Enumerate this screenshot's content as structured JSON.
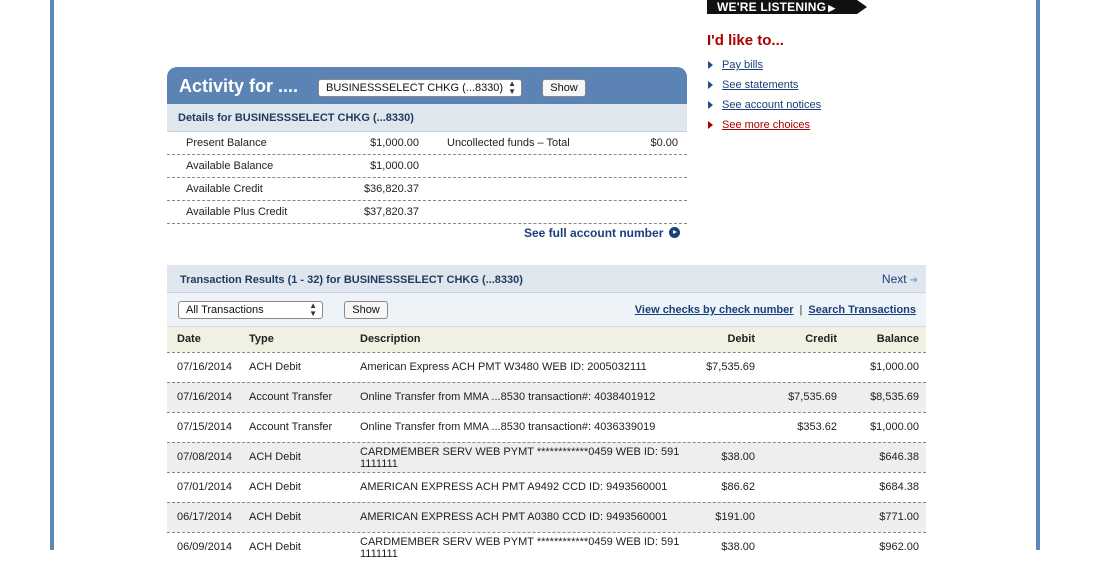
{
  "banner": {
    "text": "WE'RE LISTENING"
  },
  "like_to": {
    "heading": "I'd like to...",
    "items": [
      "Pay bills",
      "See statements",
      "See account notices",
      "See more choices"
    ]
  },
  "activity": {
    "title": "Activity for ....",
    "account_select": "BUSINESSSELECT CHKG (...8330)",
    "show_label": "Show",
    "details_title": "Details for BUSINESSSELECT CHKG (...8330)",
    "balances": [
      {
        "label": "Present Balance",
        "value": "$1,000.00",
        "label2": "Uncollected funds – Total",
        "value2": "$0.00"
      },
      {
        "label": "Available Balance",
        "value": "$1,000.00",
        "label2": "",
        "value2": ""
      },
      {
        "label": "Available Credit",
        "value": "$36,820.37",
        "label2": "",
        "value2": ""
      },
      {
        "label": "Available Plus Credit",
        "value": "$37,820.37",
        "label2": "",
        "value2": ""
      }
    ],
    "full_account_link": "See full account number"
  },
  "transactions": {
    "title": "Transaction Results (1 - 32) for BUSINESSSELECT CHKG (...8330)",
    "next_label": "Next",
    "filter_value": "All Transactions",
    "show_label": "Show",
    "link_checks": "View checks by check number",
    "link_search": "Search Transactions",
    "link_sep": "|",
    "columns": {
      "date": "Date",
      "type": "Type",
      "description": "Description",
      "debit": "Debit",
      "credit": "Credit",
      "balance": "Balance"
    },
    "rows": [
      {
        "date": "07/16/2014",
        "type": "ACH Debit",
        "description": "American Express ACH PMT W3480 WEB ID: 2005032111",
        "debit": "$7,535.69",
        "credit": "",
        "balance": "$1,000.00"
      },
      {
        "date": "07/16/2014",
        "type": "Account Transfer",
        "description": "Online Transfer from MMA ...8530 transaction#: 4038401912",
        "debit": "",
        "credit": "$7,535.69",
        "balance": "$8,535.69"
      },
      {
        "date": "07/15/2014",
        "type": "Account Transfer",
        "description": "Online Transfer from MMA ...8530 transaction#: 4036339019",
        "debit": "",
        "credit": "$353.62",
        "balance": "$1,000.00"
      },
      {
        "date": "07/08/2014",
        "type": "ACH Debit",
        "description": "CARDMEMBER SERV WEB PYMT ************0459 WEB ID: 591 1111111",
        "debit": "$38.00",
        "credit": "",
        "balance": "$646.38"
      },
      {
        "date": "07/01/2014",
        "type": "ACH Debit",
        "description": "AMERICAN EXPRESS ACH PMT A9492 CCD ID: 9493560001",
        "debit": "$86.62",
        "credit": "",
        "balance": "$684.38"
      },
      {
        "date": "06/17/2014",
        "type": "ACH Debit",
        "description": "AMERICAN EXPRESS ACH PMT A0380 CCD ID: 9493560001",
        "debit": "$191.00",
        "credit": "",
        "balance": "$771.00"
      },
      {
        "date": "06/09/2014",
        "type": "ACH Debit",
        "description": "CARDMEMBER SERV WEB PYMT ************0459 WEB ID: 591 1111111",
        "debit": "$38.00",
        "credit": "",
        "balance": "$962.00"
      }
    ]
  }
}
